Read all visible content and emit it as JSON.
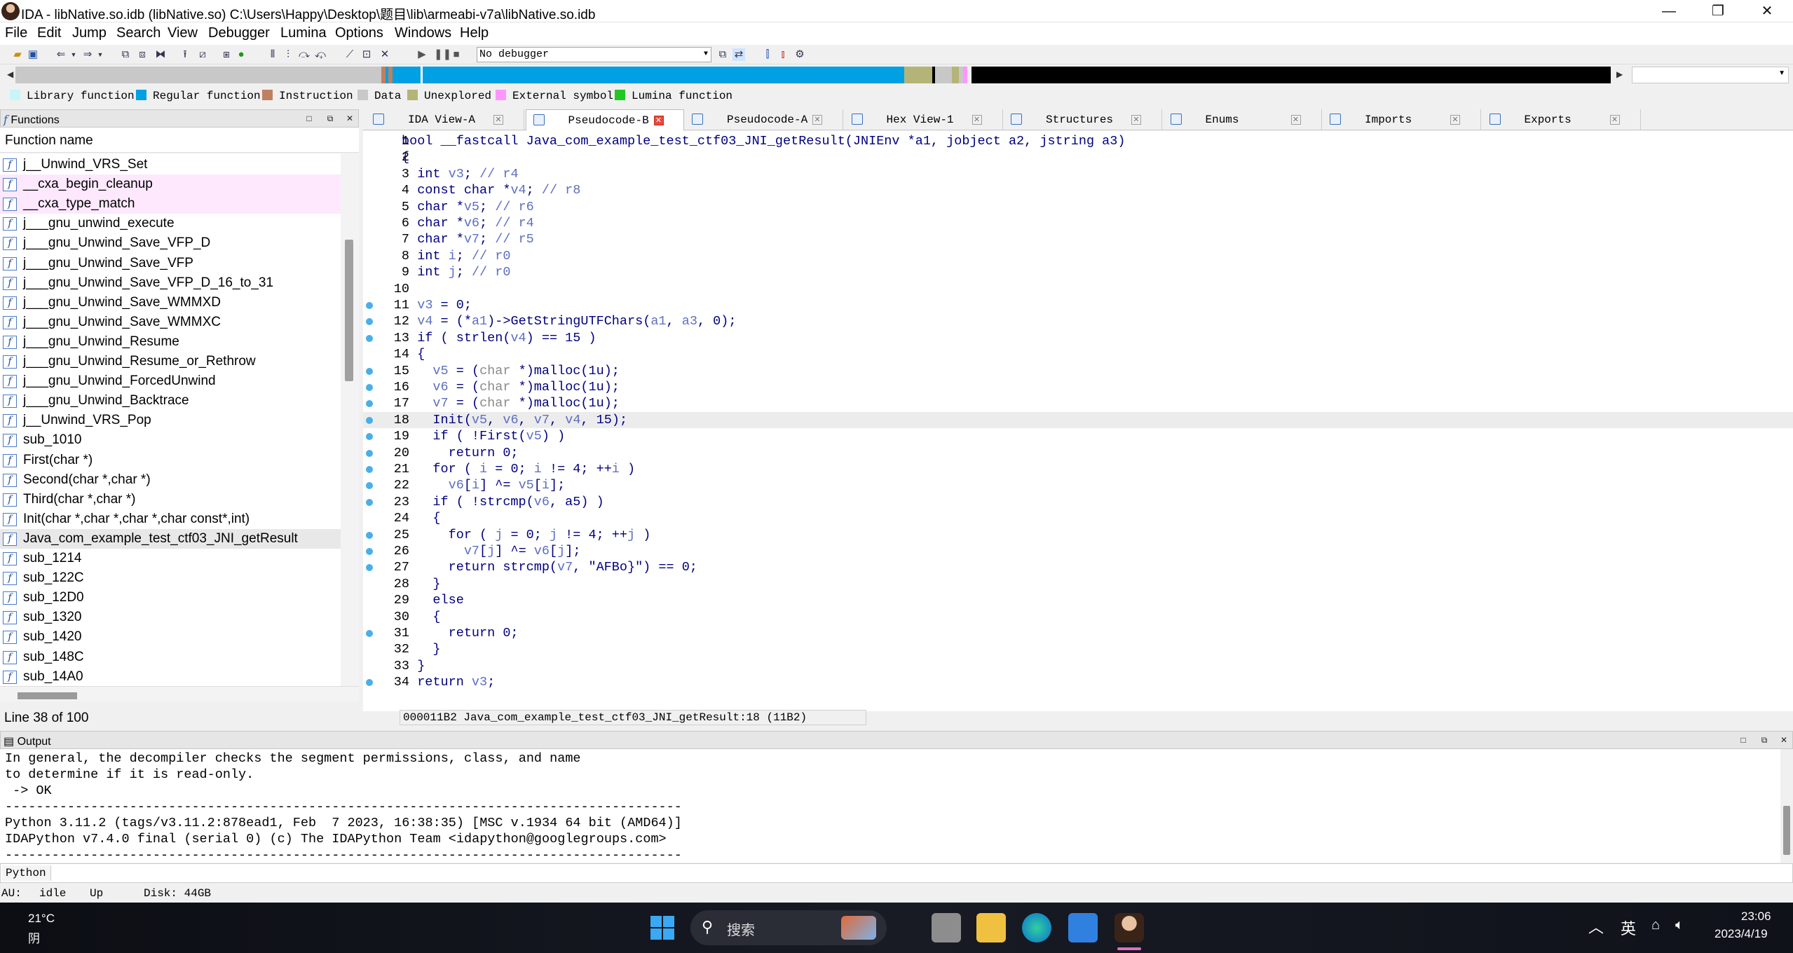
{
  "window": {
    "title": "IDA - libNative.so.idb (libNative.so) C:\\Users\\Happy\\Desktop\\题目\\lib\\armeabi-v7a\\libNative.so.idb",
    "minimize": "—",
    "maximize": "❐",
    "close": "✕"
  },
  "menu": [
    "File",
    "Edit",
    "Jump",
    "Search",
    "View",
    "Debugger",
    "Lumina",
    "Options",
    "Windows",
    "Help"
  ],
  "toolbar": {
    "debugger_value": "No debugger"
  },
  "legend": [
    {
      "label": "Library function",
      "color": "#c8f5f8"
    },
    {
      "label": "Regular function",
      "color": "#00a0e4"
    },
    {
      "label": "Instruction",
      "color": "#c08060"
    },
    {
      "label": "Data",
      "color": "#c8c8c8"
    },
    {
      "label": "Unexplored",
      "color": "#b4b478"
    },
    {
      "label": "External symbol",
      "color": "#ff96ff"
    },
    {
      "label": "Lumina function",
      "color": "#22c822"
    }
  ],
  "functions": {
    "title": "Functions",
    "column": "Function name",
    "items": [
      {
        "name": "j__Unwind_VRS_Set",
        "kind": "regular"
      },
      {
        "name": "__cxa_begin_cleanup",
        "kind": "library"
      },
      {
        "name": "__cxa_type_match",
        "kind": "library"
      },
      {
        "name": "j___gnu_unwind_execute",
        "kind": "regular"
      },
      {
        "name": "j___gnu_Unwind_Save_VFP_D",
        "kind": "regular"
      },
      {
        "name": "j___gnu_Unwind_Save_VFP",
        "kind": "regular"
      },
      {
        "name": "j___gnu_Unwind_Save_VFP_D_16_to_31",
        "kind": "regular"
      },
      {
        "name": "j___gnu_Unwind_Save_WMMXD",
        "kind": "regular"
      },
      {
        "name": "j___gnu_Unwind_Save_WMMXC",
        "kind": "regular"
      },
      {
        "name": "j___gnu_Unwind_Resume",
        "kind": "regular"
      },
      {
        "name": "j___gnu_Unwind_Resume_or_Rethrow",
        "kind": "regular"
      },
      {
        "name": "j___gnu_Unwind_ForcedUnwind",
        "kind": "regular"
      },
      {
        "name": "j___gnu_Unwind_Backtrace",
        "kind": "regular"
      },
      {
        "name": "j__Unwind_VRS_Pop",
        "kind": "regular"
      },
      {
        "name": "sub_1010",
        "kind": "regular"
      },
      {
        "name": "First(char *)",
        "kind": "regular"
      },
      {
        "name": "Second(char *,char *)",
        "kind": "regular"
      },
      {
        "name": "Third(char *,char *)",
        "kind": "regular"
      },
      {
        "name": "Init(char *,char *,char *,char const*,int)",
        "kind": "regular"
      },
      {
        "name": "Java_com_example_test_ctf03_JNI_getResult",
        "kind": "selected"
      },
      {
        "name": "sub_1214",
        "kind": "regular"
      },
      {
        "name": "sub_122C",
        "kind": "regular"
      },
      {
        "name": "sub_12D0",
        "kind": "regular"
      },
      {
        "name": "sub_1320",
        "kind": "regular"
      },
      {
        "name": "sub_1420",
        "kind": "regular"
      },
      {
        "name": "sub_148C",
        "kind": "regular"
      },
      {
        "name": "sub_14A0",
        "kind": "regular"
      }
    ],
    "status": "Line 38 of 100"
  },
  "tabs": [
    {
      "label": "IDA View-A",
      "icon": "ida-view-icon",
      "active": false
    },
    {
      "label": "Pseudocode-B",
      "icon": "pseudocode-icon",
      "active": true
    },
    {
      "label": "Pseudocode-A",
      "icon": "pseudocode-icon",
      "active": false
    },
    {
      "label": "Hex View-1",
      "icon": "hex-view-icon",
      "active": false
    },
    {
      "label": "Structures",
      "icon": "structures-icon",
      "active": false
    },
    {
      "label": "Enums",
      "icon": "enums-icon",
      "active": false
    },
    {
      "label": "Imports",
      "icon": "imports-icon",
      "active": false
    },
    {
      "label": "Exports",
      "icon": "exports-icon",
      "active": false
    }
  ],
  "code": {
    "current_line": 18,
    "lines": [
      {
        "n": "1",
        "bp": false,
        "text": "bool __fastcall Java_com_example_test_ctf03_JNI_getResult(JNIEnv *a1, jobject a2, jstring a3)"
      },
      {
        "n": "2",
        "bp": false,
        "text": "{"
      },
      {
        "n": "3",
        "bp": false,
        "text": "  int v3; // r4"
      },
      {
        "n": "4",
        "bp": false,
        "text": "  const char *v4; // r8"
      },
      {
        "n": "5",
        "bp": false,
        "text": "  char *v5; // r6"
      },
      {
        "n": "6",
        "bp": false,
        "text": "  char *v6; // r4"
      },
      {
        "n": "7",
        "bp": false,
        "text": "  char *v7; // r5"
      },
      {
        "n": "8",
        "bp": false,
        "text": "  int i; // r0"
      },
      {
        "n": "9",
        "bp": false,
        "text": "  int j; // r0"
      },
      {
        "n": "10",
        "bp": false,
        "text": ""
      },
      {
        "n": "11",
        "bp": true,
        "text": "  v3 = 0;"
      },
      {
        "n": "12",
        "bp": true,
        "text": "  v4 = (*a1)->GetStringUTFChars(a1, a3, 0);"
      },
      {
        "n": "13",
        "bp": true,
        "text": "  if ( strlen(v4) == 15 )"
      },
      {
        "n": "14",
        "bp": false,
        "text": "  {"
      },
      {
        "n": "15",
        "bp": true,
        "text": "    v5 = (char *)malloc(1u);"
      },
      {
        "n": "16",
        "bp": true,
        "text": "    v6 = (char *)malloc(1u);"
      },
      {
        "n": "17",
        "bp": true,
        "text": "    v7 = (char *)malloc(1u);"
      },
      {
        "n": "18",
        "bp": true,
        "text": "    Init(v5, v6, v7, v4, 15);"
      },
      {
        "n": "19",
        "bp": true,
        "text": "    if ( !First(v5) )"
      },
      {
        "n": "20",
        "bp": true,
        "text": "      return 0;"
      },
      {
        "n": "21",
        "bp": true,
        "text": "    for ( i = 0; i != 4; ++i )"
      },
      {
        "n": "22",
        "bp": true,
        "text": "      v6[i] ^= v5[i];"
      },
      {
        "n": "23",
        "bp": true,
        "text": "    if ( !strcmp(v6, a5) )"
      },
      {
        "n": "24",
        "bp": false,
        "text": "    {"
      },
      {
        "n": "25",
        "bp": true,
        "text": "      for ( j = 0; j != 4; ++j )"
      },
      {
        "n": "26",
        "bp": true,
        "text": "        v7[j] ^= v6[j];"
      },
      {
        "n": "27",
        "bp": true,
        "text": "      return strcmp(v7, \"AFBo}\") == 0;"
      },
      {
        "n": "28",
        "bp": false,
        "text": "    }"
      },
      {
        "n": "29",
        "bp": false,
        "text": "    else"
      },
      {
        "n": "30",
        "bp": false,
        "text": "    {"
      },
      {
        "n": "31",
        "bp": true,
        "text": "      return 0;"
      },
      {
        "n": "32",
        "bp": false,
        "text": "    }"
      },
      {
        "n": "33",
        "bp": false,
        "text": "  }"
      },
      {
        "n": "34",
        "bp": true,
        "text": "  return v3;"
      },
      {
        "n": "35",
        "bp": true,
        "text": "}"
      }
    ],
    "status": "000011B2 Java_com_example_test_ctf03_JNI_getResult:18 (11B2)"
  },
  "output": {
    "title": "Output",
    "lines": [
      "In general, the decompiler checks the segment permissions, class, and name",
      "to determine if it is read-only.",
      " -> OK",
      "---------------------------------------------------------------------------------------",
      "Python 3.11.2 (tags/v3.11.2:878ead1, Feb  7 2023, 16:38:35) [MSC v.1934 64 bit (AMD64)]",
      "IDAPython v7.4.0 final (serial 0) (c) The IDAPython Team <idapython@googlegroups.com>",
      "---------------------------------------------------------------------------------------"
    ]
  },
  "python_label": "Python",
  "ida_status": {
    "au_label": "AU:",
    "au_value": "idle",
    "direction": "Up",
    "disk": "Disk: 44GB"
  },
  "taskbar": {
    "weather_temp": "21°C",
    "weather_desc": "阴",
    "search": "搜索",
    "ime": "英",
    "time": "23:06",
    "date": "2023/4/19"
  }
}
